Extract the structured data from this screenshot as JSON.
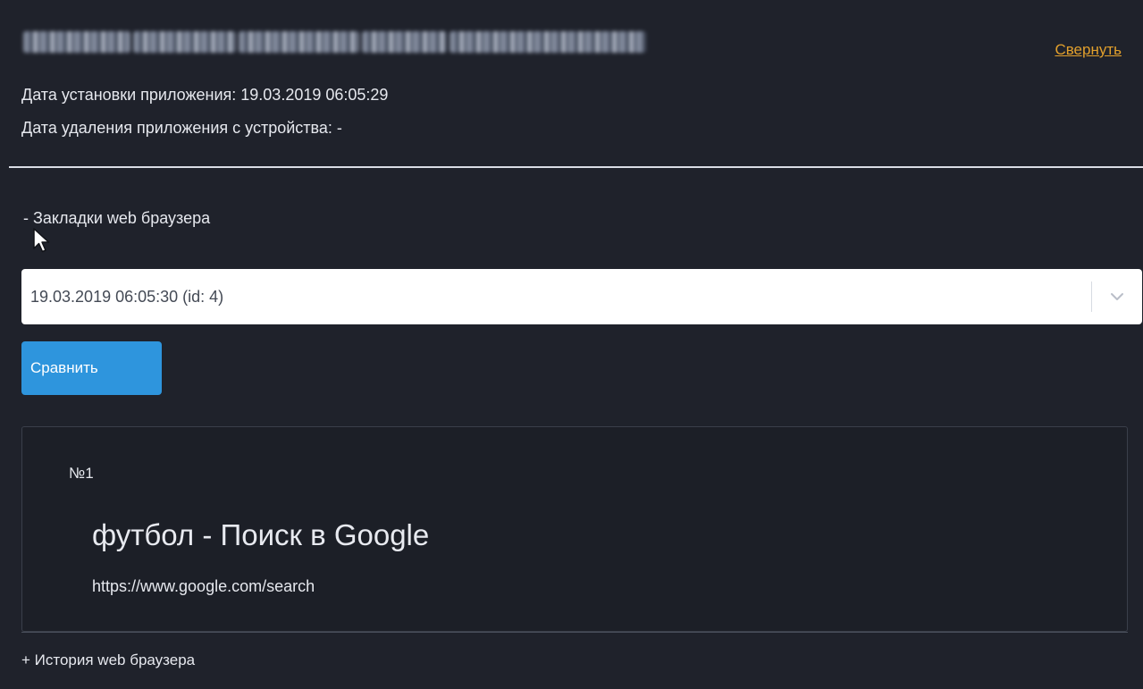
{
  "header": {
    "collapse_label": "Свернуть",
    "install_date_line": "Дата установки приложения: 19.03.2019 06:05:29",
    "removal_date_line": "Дата удаления приложения с устройства: -"
  },
  "bookmarks_section": {
    "toggle_label": "- Закладки web браузера",
    "snapshot_select": {
      "selected_value": "19.03.2019 06:05:30 (id: 4)"
    },
    "compare_button_label": "Сравнить",
    "items": [
      {
        "number": "№1",
        "title": "футбол - Поиск в Google",
        "url": "https://www.google.com/search"
      }
    ]
  },
  "history_section": {
    "toggle_label": "+ История web браузера"
  },
  "colors": {
    "background": "#1f222b",
    "link_accent": "#e2a02c",
    "button_primary": "#2e95dd"
  }
}
